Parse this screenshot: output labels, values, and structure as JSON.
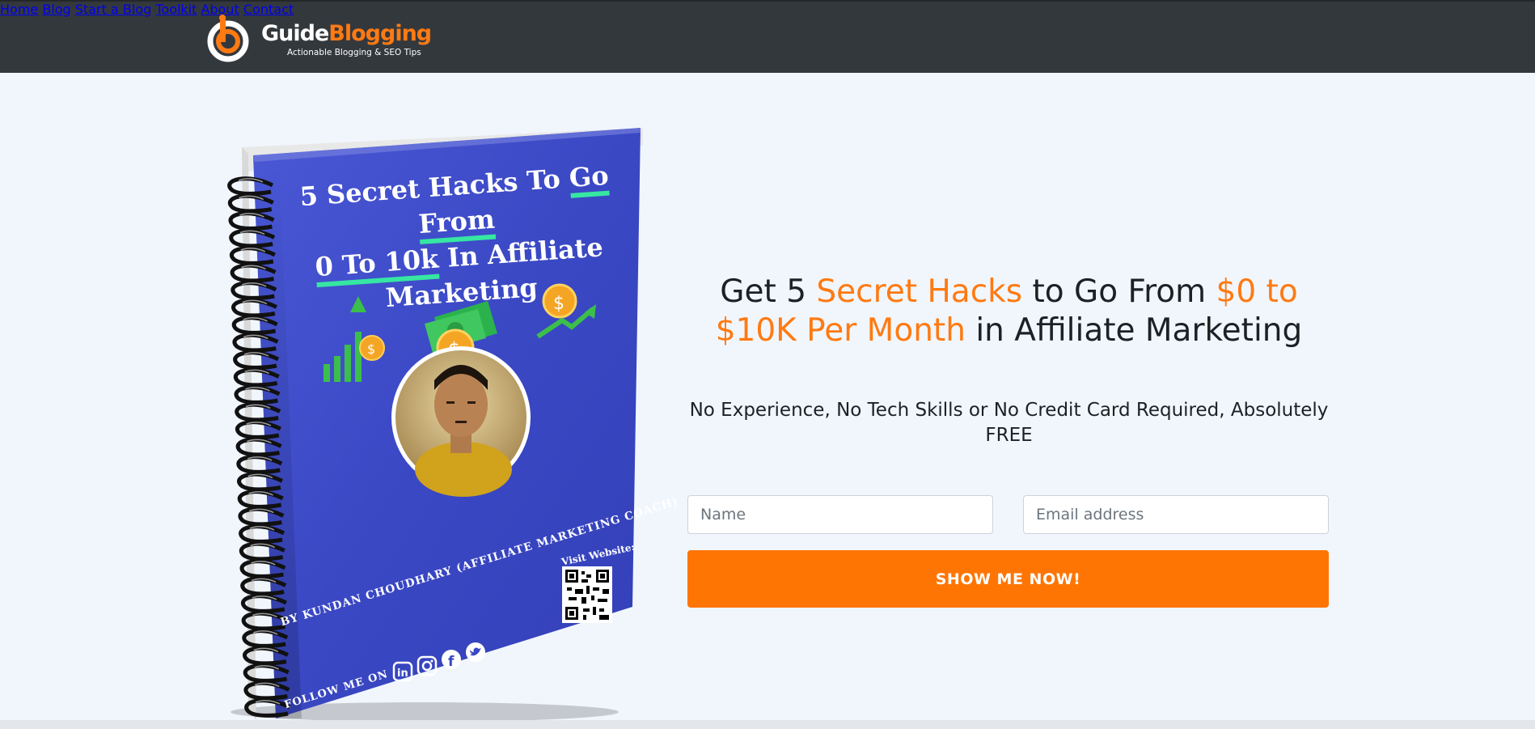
{
  "brand": {
    "name_part1": "Guide",
    "name_part2": "Blogging",
    "tagline": "Actionable Blogging & SEO Tips",
    "colors": {
      "navbar": "#33383d",
      "accent": "#ff7a12",
      "cover": "#3a48c4"
    }
  },
  "nav": {
    "items": [
      {
        "label": "Home"
      },
      {
        "label": "Blog"
      },
      {
        "label": "Start a Blog"
      },
      {
        "label": "Toolkit"
      },
      {
        "label": "About"
      },
      {
        "label": "Contact"
      }
    ]
  },
  "book": {
    "title_part1": "5 Secret Hacks To ",
    "title_part2": "Go From",
    "title_part3": "0 To 10k",
    "title_part4": " In Affiliate Marketing",
    "author": "BY KUNDAN CHOUDHARY (AFFILIATE MARKETING COACH)",
    "visit": "Visit Website:",
    "follow": "FOLLOW  ME ON",
    "social_icons": [
      "linkedin-icon",
      "instagram-icon",
      "facebook-icon",
      "twitter-icon"
    ]
  },
  "hero": {
    "h_1": "Get 5 ",
    "h_2": "Secret Hacks",
    "h_3": " to Go From ",
    "h_4": "$0 to $10K Per Month",
    "h_5": " in Affiliate Marketing",
    "subheading": "No Experience, No Tech Skills or No Credit Card Required, Absolutely FREE"
  },
  "form": {
    "name_placeholder": "Name",
    "email_placeholder": "Email address",
    "submit_label": "SHOW ME NOW!"
  }
}
